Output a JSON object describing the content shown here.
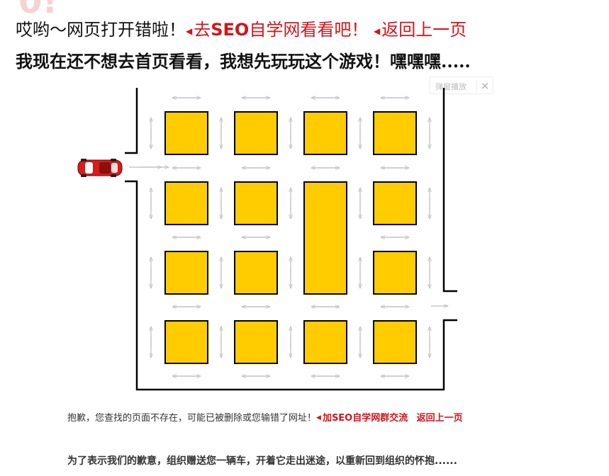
{
  "header": {
    "line1_text": "哎哟～网页打开错啦！",
    "link_seo_prefix": "去",
    "link_seo_brand": "SEO",
    "link_seo_suffix": "自学网看看吧！",
    "link_back_label": "返回上一页",
    "line2_text": "我现在还不想去首页看看，我想先玩玩这个游戏！嘿嘿嘿....."
  },
  "popup_tag": {
    "label": "弹窗播放",
    "close_symbol": "×"
  },
  "game": {
    "block_color": "#ffcc00",
    "wall_color": "#000000",
    "car_color": "#d81b1b",
    "arrow_color": "#bfbfbf"
  },
  "footer": {
    "apology_text": "抱歉，您查找的页面不存在，可能已被删除或您输错了网址！",
    "link_group_label": "加SEO自学网群交流",
    "link_back_label": "返回上一页",
    "gift_text": "为了表示我们的歉意，组织赠送您一辆车，开着它走出迷途，以重新回到组织的怀抱......"
  },
  "colors": {
    "link_red": "#d3151b"
  }
}
